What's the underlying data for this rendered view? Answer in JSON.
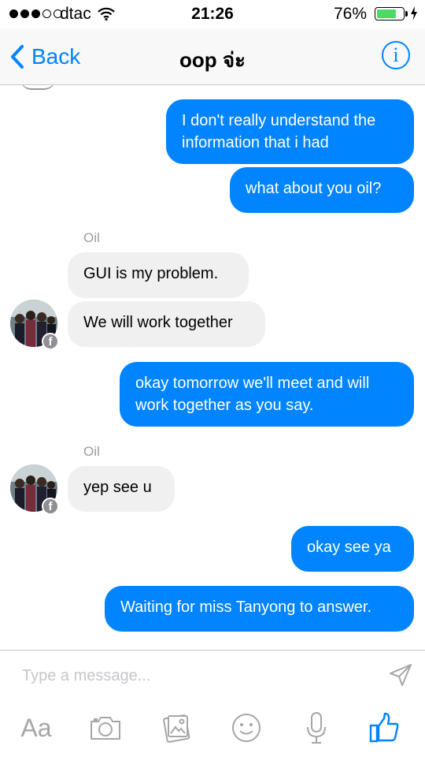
{
  "status_bar": {
    "carrier": "dtac",
    "time": "21:26",
    "battery_percent": "76%",
    "battery_level": 0.76,
    "signal_bars": 3,
    "signal_total": 5
  },
  "nav": {
    "back_label": "Back",
    "title": "oop จ่ะ",
    "info_label": "i"
  },
  "messages": [
    {
      "direction": "outgoing",
      "lines": [
        "I don't really understand the",
        "information that i had"
      ]
    },
    {
      "direction": "outgoing",
      "lines": [
        "what about you oil?"
      ]
    },
    {
      "direction": "incoming",
      "sender": "Oil",
      "lines": [
        "GUI is my problem."
      ]
    },
    {
      "direction": "incoming",
      "lines": [
        "We will work together"
      ]
    },
    {
      "direction": "outgoing",
      "lines": [
        "okay tomorrow we'll meet and will",
        "work together as you say."
      ]
    },
    {
      "direction": "incoming",
      "sender": "Oil",
      "lines": [
        "yep see u"
      ]
    },
    {
      "direction": "outgoing",
      "lines": [
        "okay see ya"
      ]
    },
    {
      "direction": "outgoing",
      "lines": [
        "Waiting for miss Tanyong to answer."
      ]
    }
  ],
  "badge_letter": "f",
  "composer": {
    "placeholder": "Type a message...",
    "toolbar": {
      "text_label": "Aa",
      "icons": [
        "text-format-icon",
        "camera-icon",
        "photo-gallery-icon",
        "emoji-icon",
        "microphone-icon",
        "like-thumb-icon"
      ]
    }
  },
  "colors": {
    "accent": "#0084ff",
    "incoming_bubble": "#f1f0f0",
    "battery": "#4cd964"
  }
}
